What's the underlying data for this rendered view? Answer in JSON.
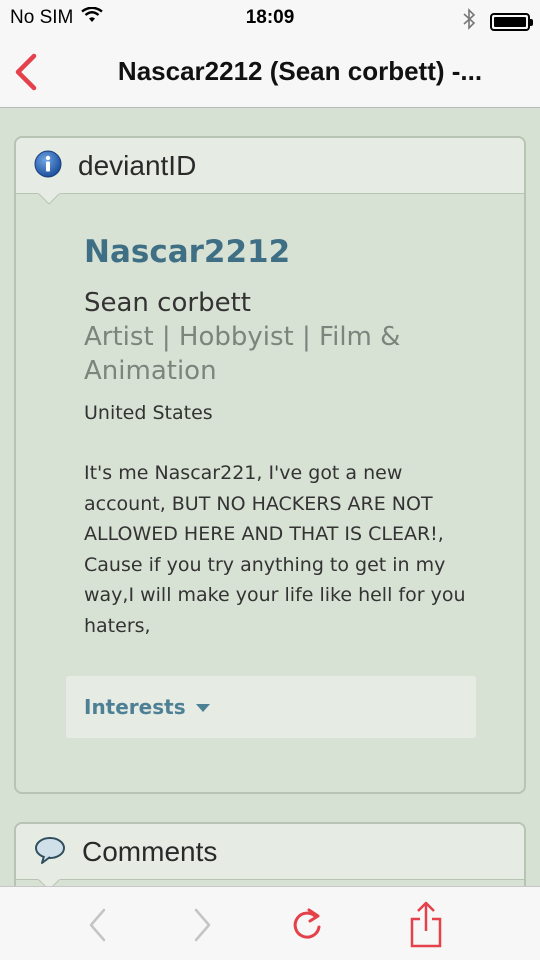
{
  "status_bar": {
    "carrier": "No SIM",
    "time": "18:09"
  },
  "nav": {
    "title": "Nascar2212 (Sean corbett) -..."
  },
  "deviant_id": {
    "header": "deviantID",
    "username": "Nascar2212",
    "real_name": "Sean corbett",
    "tagline": "Artist | Hobbyist | Film & Animation",
    "location": "United States",
    "bio": "It's me Nascar221, I've got a new account, BUT NO HACKERS ARE NOT ALLOWED HERE AND THAT IS CLEAR!, Cause if you try anything to get in my way,I will make your life like hell for you haters,",
    "interests_label": "Interests"
  },
  "comments": {
    "header": "Comments"
  },
  "colors": {
    "accent_red": "#e5414a",
    "link_teal": "#3f6f84",
    "card_bg": "#d8e2d4"
  }
}
